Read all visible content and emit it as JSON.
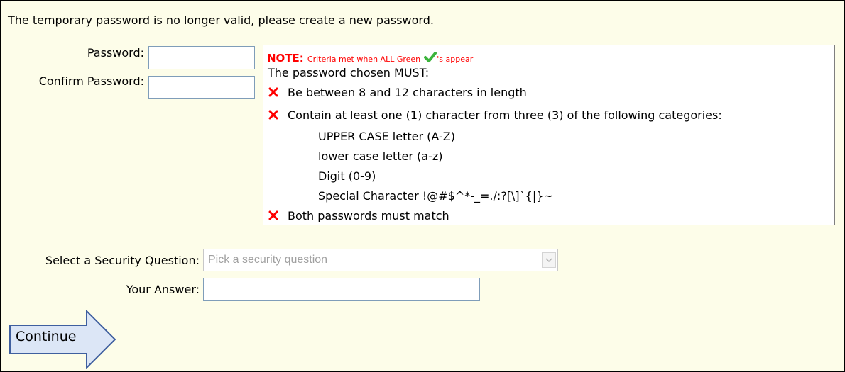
{
  "intro_text": "The temporary password is no longer valid, please create a new password.",
  "password": {
    "label": "Password:",
    "value": ""
  },
  "confirm_password": {
    "label": "Confirm Password:",
    "value": ""
  },
  "note": {
    "heading": "NOTE:",
    "text_before_icon": "Criteria met when ALL Green",
    "text_after_icon": "'s appear",
    "must_text": "The password chosen MUST:",
    "criteria": [
      {
        "text": "Be between 8 and 12 characters in length",
        "status": "unmet"
      },
      {
        "text": "Contain at least one (1) character from three (3) of the following categories:",
        "status": "unmet"
      },
      {
        "text": "Both passwords must match",
        "status": "unmet"
      }
    ],
    "categories": [
      "UPPER CASE letter (A-Z)",
      "lower case letter (a-z)",
      "Digit (0-9)",
      "Special Character !@#$^*-_=./:?[\\]`{|}~"
    ]
  },
  "security_question": {
    "label": "Select a Security Question:",
    "placeholder": "Pick a security question"
  },
  "answer": {
    "label": "Your Answer:",
    "value": ""
  },
  "continue_label": "Continue",
  "colors": {
    "page_bg": "#fdfde9",
    "note_red": "#ff0000",
    "check_green": "#3cb43c",
    "button_fill": "#dce6f6",
    "button_border": "#3f5f9f"
  }
}
